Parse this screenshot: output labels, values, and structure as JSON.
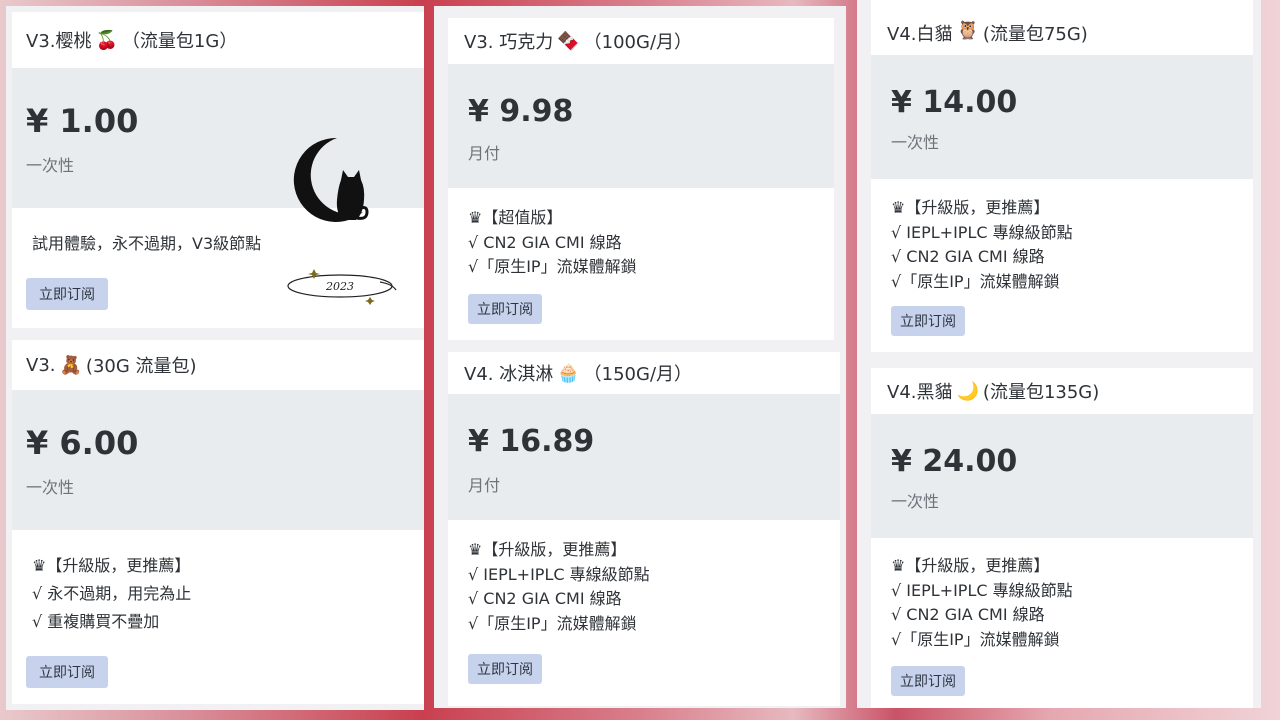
{
  "plans": {
    "cherry": {
      "title": "V3.樱桃",
      "title_suffix": "（流量包1G）",
      "icon": "cherry-emoji",
      "icon_glyph": "🍒",
      "price": "¥ 1.00",
      "period": "一次性",
      "features": [
        "試用體驗，永不過期，V3級節點"
      ],
      "button": "立即订阅",
      "badge_text": "2023"
    },
    "bear": {
      "title": "V3.",
      "title_suffix": "(30G 流量包)",
      "icon": "teddy-bear-emoji",
      "icon_glyph": "🧸",
      "price": "¥ 6.00",
      "period": "一次性",
      "features": [
        "♛【升級版，更推薦】",
        "√ 永不過期，用完為止",
        "√ 重複購買不疊加"
      ],
      "button": "立即订阅"
    },
    "chocolate": {
      "title": "V3. 巧克力",
      "title_suffix": "（100G/月）",
      "icon": "chocolate-emoji",
      "icon_glyph": "🍫",
      "price": "¥ 9.98",
      "period": "月付",
      "features": [
        "♛【超值版】",
        "√ CN2 GIA CMI 線路",
        "√「原生IP」流媒體解鎖"
      ],
      "button": "立即订阅"
    },
    "icecream": {
      "title": "V4. 冰淇淋",
      "title_suffix": "（150G/月）",
      "icon": "cupcake-emoji",
      "icon_glyph": "🧁",
      "price": "¥ 16.89",
      "period": "月付",
      "features": [
        "♛【升級版，更推薦】",
        "√ IEPL+IPLC 專線級節點",
        "√ CN2 GIA CMI 線路",
        "√「原生IP」流媒體解鎖"
      ],
      "button": "立即订阅"
    },
    "whitecat": {
      "title": "V4.白貓",
      "title_suffix": "(流量包75G)",
      "icon": "owl-emoji",
      "icon_glyph": "🦉",
      "price": "¥ 14.00",
      "period": "一次性",
      "features": [
        "♛【升級版，更推薦】",
        "√ IEPL+IPLC 專線級節點",
        "√ CN2 GIA CMI 線路",
        "√「原生IP」流媒體解鎖"
      ],
      "button": "立即订阅"
    },
    "blackcat": {
      "title": "V4.黑貓",
      "title_suffix": "(流量包135G)",
      "icon": "crescent-moon-emoji",
      "icon_glyph": "🌙",
      "price": "¥ 24.00",
      "period": "一次性",
      "features": [
        "♛【升級版，更推薦】",
        "√ IEPL+IPLC 專線級節點",
        "√ CN2 GIA CMI 線路",
        "√「原生IP」流媒體解鎖"
      ],
      "button": "立即订阅"
    }
  }
}
